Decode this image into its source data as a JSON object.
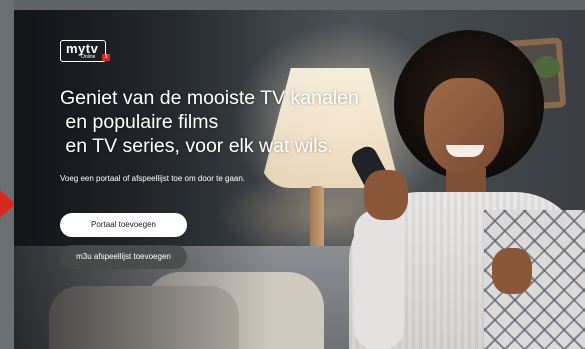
{
  "logo": {
    "brand": "mytv",
    "sub": "Online",
    "badge": "3"
  },
  "hero": {
    "headline_lines": [
      "Geniet van de mooiste TV kanalen",
      " en populaire films",
      " en TV series, voor elk wat wils."
    ],
    "subtext": "Voeg een portaal of afspeellijst toe om door te gaan."
  },
  "actions": {
    "primary_label": "Portaal toevoegen",
    "secondary_label": "m3u afspeellijst toevoegen"
  },
  "colors": {
    "accent": "#d62a1e",
    "primary_button_bg": "#ffffff",
    "secondary_button_bg": "#464a48"
  },
  "icons": {
    "pointer": "red-arrow-icon"
  }
}
